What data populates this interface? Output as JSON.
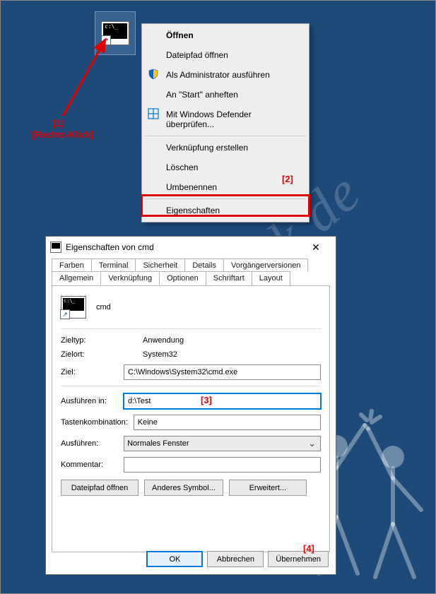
{
  "annotations": {
    "marker1": "[1]",
    "marker1_label": "[Rechts-Klick]",
    "marker2": "[2]",
    "marker3": "[3]",
    "marker4": "[4]"
  },
  "watermark_text": "SoftwareOk.de",
  "context_menu": {
    "items": {
      "open": "Öffnen",
      "open_path": "Dateipfad öffnen",
      "run_admin": "Als Administrator ausführen",
      "pin_start": "An \"Start\" anheften",
      "defender": "Mit Windows Defender überprüfen...",
      "create_shortcut": "Verknüpfung erstellen",
      "delete": "Löschen",
      "rename": "Umbenennen",
      "properties": "Eigenschaften"
    }
  },
  "properties": {
    "title": "Eigenschaften von cmd",
    "name_value": "cmd",
    "tabs_row1": {
      "t0": "Farben",
      "t1": "Terminal",
      "t2": "Sicherheit",
      "t3": "Details",
      "t4": "Vorgängerversionen"
    },
    "tabs_row2": {
      "t0": "Allgemein",
      "t1": "Verknüpfung",
      "t2": "Optionen",
      "t3": "Schriftart",
      "t4": "Layout"
    },
    "fields": {
      "target_type_lbl": "Zieltyp:",
      "target_type_val": "Anwendung",
      "target_loc_lbl": "Zielort:",
      "target_loc_val": "System32",
      "target_lbl": "Ziel:",
      "target_val": "C:\\Windows\\System32\\cmd.exe",
      "startin_lbl": "Ausführen in:",
      "startin_val": "d:\\Test",
      "hotkey_lbl": "Tastenkombination:",
      "hotkey_val": "Keine",
      "run_lbl": "Ausführen:",
      "run_val": "Normales Fenster",
      "comment_lbl": "Kommentar:",
      "comment_val": ""
    },
    "buttons": {
      "openpath": "Dateipfad öffnen",
      "changeicon": "Anderes Symbol...",
      "advanced": "Erweitert...",
      "ok": "OK",
      "cancel": "Abbrechen",
      "apply": "Übernehmen"
    }
  }
}
